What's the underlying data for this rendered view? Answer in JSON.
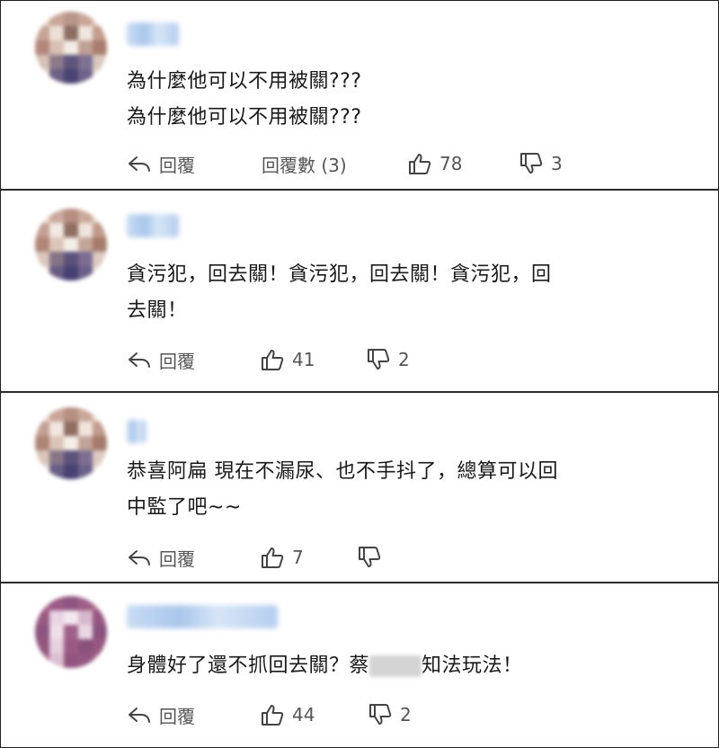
{
  "comments": [
    {
      "text_lines": [
        "為什麼他可以不用被關???",
        "為什麼他可以不用被關???"
      ],
      "reply_label": "回覆",
      "reply_count_label": "回覆數 (3)",
      "likes": "78",
      "dislikes": "3"
    },
    {
      "text_lines": [
        "貪污犯，回去關！貪污犯，回去關！貪污犯，回",
        "去關！"
      ],
      "reply_label": "回覆",
      "likes": "41",
      "dislikes": "2"
    },
    {
      "text_lines": [
        "恭喜阿扁 現在不漏尿、也不手抖了，總算可以回",
        "中監了吧~~"
      ],
      "reply_label": "回覆",
      "likes": "7",
      "dislikes": ""
    },
    {
      "text_before": "身體好了還不抓回去關？蔡",
      "text_after": "知法玩法！",
      "reply_label": "回覆",
      "likes": "44",
      "dislikes": "2"
    }
  ],
  "icons": {
    "reply": "reply-arrow-icon",
    "like": "thumbs-up-icon",
    "dislike": "thumbs-down-icon"
  },
  "colors": {
    "text": "#1a1a1a",
    "action_text": "#555555",
    "divider": "#2a2a2a",
    "username_blur": "#a9c6ec"
  }
}
